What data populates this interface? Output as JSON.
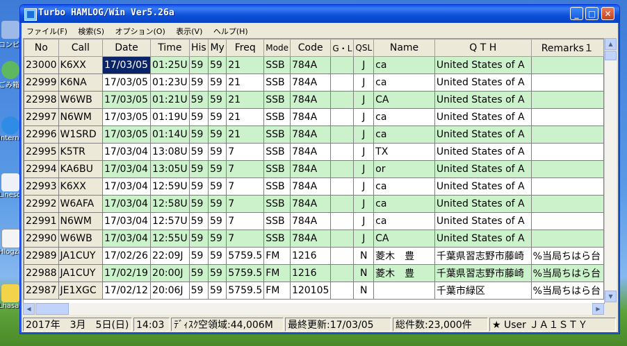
{
  "window": {
    "title": "Turbo HAMLOG/Win Ver5.26a"
  },
  "menu": [
    "ファイル(F)",
    "検索(S)",
    "オプション(O)",
    "表示(V)",
    "ヘルプ(H)"
  ],
  "desktop_icons": [
    "コンピ",
    "ごみ箱",
    "Internet Explorer",
    "Lineso System",
    "Hlogzo",
    "Lhasa"
  ],
  "columns": [
    "No",
    "Call",
    "Date",
    "Time",
    "His",
    "My",
    "Freq",
    "Mode",
    "Code",
    "G・L",
    "QSL",
    "Name",
    "Q T H",
    "Remarks１"
  ],
  "rows": [
    [
      "23000",
      "K6XX",
      "17/03/05",
      "01:25U",
      "59",
      "59",
      "21",
      "SSB",
      "784A",
      "",
      "J",
      "ca",
      "United States of A",
      ""
    ],
    [
      "22999",
      "K6NA",
      "17/03/05",
      "01:23U",
      "59",
      "59",
      "21",
      "SSB",
      "784A",
      "",
      "J",
      "ca",
      "United States of A",
      ""
    ],
    [
      "22998",
      "W6WB",
      "17/03/05",
      "01:21U",
      "59",
      "59",
      "21",
      "SSB",
      "784A",
      "",
      "J",
      "CA",
      "United States of A",
      ""
    ],
    [
      "22997",
      "N6WM",
      "17/03/05",
      "01:19U",
      "59",
      "59",
      "21",
      "SSB",
      "784A",
      "",
      "J",
      "ca",
      "United States of A",
      ""
    ],
    [
      "22996",
      "W1SRD",
      "17/03/05",
      "01:14U",
      "59",
      "59",
      "21",
      "SSB",
      "784A",
      "",
      "J",
      "ca",
      "United States of A",
      ""
    ],
    [
      "22995",
      "K5TR",
      "17/03/04",
      "13:08U",
      "59",
      "59",
      "7",
      "SSB",
      "784A",
      "",
      "J",
      "TX",
      "United States of A",
      ""
    ],
    [
      "22994",
      "KA6BU",
      "17/03/04",
      "13:05U",
      "59",
      "59",
      "7",
      "SSB",
      "784A",
      "",
      "J",
      "or",
      "United States of A",
      ""
    ],
    [
      "22993",
      "K6XX",
      "17/03/04",
      "12:59U",
      "59",
      "59",
      "7",
      "SSB",
      "784A",
      "",
      "J",
      "ca",
      "United States of A",
      ""
    ],
    [
      "22992",
      "W6AFA",
      "17/03/04",
      "12:58U",
      "59",
      "59",
      "7",
      "SSB",
      "784A",
      "",
      "J",
      "ca",
      "United States of A",
      ""
    ],
    [
      "22991",
      "N6WM",
      "17/03/04",
      "12:57U",
      "59",
      "59",
      "7",
      "SSB",
      "784A",
      "",
      "J",
      "ca",
      "United States of A",
      ""
    ],
    [
      "22990",
      "W6WB",
      "17/03/04",
      "12:55U",
      "59",
      "59",
      "7",
      "SSB",
      "784A",
      "",
      "J",
      "CA",
      "United States of A",
      ""
    ],
    [
      "22989",
      "JA1CUY",
      "17/02/26",
      "22:09J",
      "59",
      "59",
      "5759.5",
      "FM",
      "1216",
      "",
      "N",
      "菱木　豊",
      "千葉県習志野市藤崎",
      "%当局ちはら台"
    ],
    [
      "22988",
      "JA1CUY",
      "17/02/19",
      "20:00J",
      "59",
      "59",
      "5759.5",
      "FM",
      "1216",
      "",
      "N",
      "菱木　豊",
      "千葉県習志野市藤崎",
      "%当局ちはら台"
    ],
    [
      "22987",
      "JE1XGC",
      "17/02/12",
      "20:06J",
      "59",
      "59",
      "5759.5",
      "FM",
      "120105",
      "",
      "N",
      "",
      "千葉市緑区",
      "%当局ちはら台"
    ]
  ],
  "status": {
    "date": "2017年　3月　5日(日)",
    "time": "14:03",
    "disk": "ﾃﾞｨｽｸ空領域:44,006M",
    "updated": "最終更新:17/03/05",
    "total": "総件数:23,000件",
    "user": "★ User ＪＡ１ＳＴＹ"
  }
}
